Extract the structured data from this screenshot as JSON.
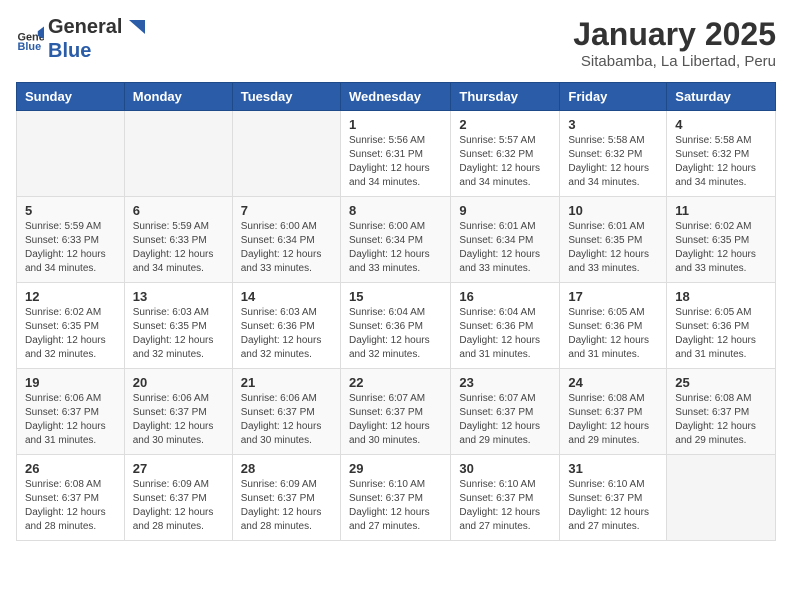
{
  "header": {
    "logo_general": "General",
    "logo_blue": "Blue",
    "title": "January 2025",
    "subtitle": "Sitabamba, La Libertad, Peru"
  },
  "days_of_week": [
    "Sunday",
    "Monday",
    "Tuesday",
    "Wednesday",
    "Thursday",
    "Friday",
    "Saturday"
  ],
  "weeks": [
    [
      {
        "day": "",
        "info": ""
      },
      {
        "day": "",
        "info": ""
      },
      {
        "day": "",
        "info": ""
      },
      {
        "day": "1",
        "info": "Sunrise: 5:56 AM\nSunset: 6:31 PM\nDaylight: 12 hours\nand 34 minutes."
      },
      {
        "day": "2",
        "info": "Sunrise: 5:57 AM\nSunset: 6:32 PM\nDaylight: 12 hours\nand 34 minutes."
      },
      {
        "day": "3",
        "info": "Sunrise: 5:58 AM\nSunset: 6:32 PM\nDaylight: 12 hours\nand 34 minutes."
      },
      {
        "day": "4",
        "info": "Sunrise: 5:58 AM\nSunset: 6:32 PM\nDaylight: 12 hours\nand 34 minutes."
      }
    ],
    [
      {
        "day": "5",
        "info": "Sunrise: 5:59 AM\nSunset: 6:33 PM\nDaylight: 12 hours\nand 34 minutes."
      },
      {
        "day": "6",
        "info": "Sunrise: 5:59 AM\nSunset: 6:33 PM\nDaylight: 12 hours\nand 34 minutes."
      },
      {
        "day": "7",
        "info": "Sunrise: 6:00 AM\nSunset: 6:34 PM\nDaylight: 12 hours\nand 33 minutes."
      },
      {
        "day": "8",
        "info": "Sunrise: 6:00 AM\nSunset: 6:34 PM\nDaylight: 12 hours\nand 33 minutes."
      },
      {
        "day": "9",
        "info": "Sunrise: 6:01 AM\nSunset: 6:34 PM\nDaylight: 12 hours\nand 33 minutes."
      },
      {
        "day": "10",
        "info": "Sunrise: 6:01 AM\nSunset: 6:35 PM\nDaylight: 12 hours\nand 33 minutes."
      },
      {
        "day": "11",
        "info": "Sunrise: 6:02 AM\nSunset: 6:35 PM\nDaylight: 12 hours\nand 33 minutes."
      }
    ],
    [
      {
        "day": "12",
        "info": "Sunrise: 6:02 AM\nSunset: 6:35 PM\nDaylight: 12 hours\nand 32 minutes."
      },
      {
        "day": "13",
        "info": "Sunrise: 6:03 AM\nSunset: 6:35 PM\nDaylight: 12 hours\nand 32 minutes."
      },
      {
        "day": "14",
        "info": "Sunrise: 6:03 AM\nSunset: 6:36 PM\nDaylight: 12 hours\nand 32 minutes."
      },
      {
        "day": "15",
        "info": "Sunrise: 6:04 AM\nSunset: 6:36 PM\nDaylight: 12 hours\nand 32 minutes."
      },
      {
        "day": "16",
        "info": "Sunrise: 6:04 AM\nSunset: 6:36 PM\nDaylight: 12 hours\nand 31 minutes."
      },
      {
        "day": "17",
        "info": "Sunrise: 6:05 AM\nSunset: 6:36 PM\nDaylight: 12 hours\nand 31 minutes."
      },
      {
        "day": "18",
        "info": "Sunrise: 6:05 AM\nSunset: 6:36 PM\nDaylight: 12 hours\nand 31 minutes."
      }
    ],
    [
      {
        "day": "19",
        "info": "Sunrise: 6:06 AM\nSunset: 6:37 PM\nDaylight: 12 hours\nand 31 minutes."
      },
      {
        "day": "20",
        "info": "Sunrise: 6:06 AM\nSunset: 6:37 PM\nDaylight: 12 hours\nand 30 minutes."
      },
      {
        "day": "21",
        "info": "Sunrise: 6:06 AM\nSunset: 6:37 PM\nDaylight: 12 hours\nand 30 minutes."
      },
      {
        "day": "22",
        "info": "Sunrise: 6:07 AM\nSunset: 6:37 PM\nDaylight: 12 hours\nand 30 minutes."
      },
      {
        "day": "23",
        "info": "Sunrise: 6:07 AM\nSunset: 6:37 PM\nDaylight: 12 hours\nand 29 minutes."
      },
      {
        "day": "24",
        "info": "Sunrise: 6:08 AM\nSunset: 6:37 PM\nDaylight: 12 hours\nand 29 minutes."
      },
      {
        "day": "25",
        "info": "Sunrise: 6:08 AM\nSunset: 6:37 PM\nDaylight: 12 hours\nand 29 minutes."
      }
    ],
    [
      {
        "day": "26",
        "info": "Sunrise: 6:08 AM\nSunset: 6:37 PM\nDaylight: 12 hours\nand 28 minutes."
      },
      {
        "day": "27",
        "info": "Sunrise: 6:09 AM\nSunset: 6:37 PM\nDaylight: 12 hours\nand 28 minutes."
      },
      {
        "day": "28",
        "info": "Sunrise: 6:09 AM\nSunset: 6:37 PM\nDaylight: 12 hours\nand 28 minutes."
      },
      {
        "day": "29",
        "info": "Sunrise: 6:10 AM\nSunset: 6:37 PM\nDaylight: 12 hours\nand 27 minutes."
      },
      {
        "day": "30",
        "info": "Sunrise: 6:10 AM\nSunset: 6:37 PM\nDaylight: 12 hours\nand 27 minutes."
      },
      {
        "day": "31",
        "info": "Sunrise: 6:10 AM\nSunset: 6:37 PM\nDaylight: 12 hours\nand 27 minutes."
      },
      {
        "day": "",
        "info": ""
      }
    ]
  ]
}
